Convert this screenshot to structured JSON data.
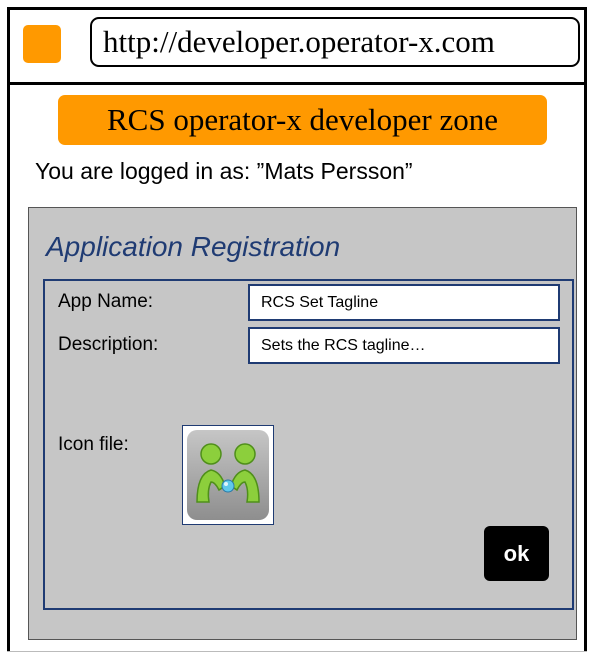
{
  "browser": {
    "url": "http://developer.operator-x.com",
    "button_icon": "square-icon",
    "accent_color": "#ff9900"
  },
  "site": {
    "banner_title": "RCS operator-x developer zone",
    "login_status": "You are logged in as: ”Mats Persson”"
  },
  "registration": {
    "title": "Application Registration",
    "title_color": "#1f3b73",
    "app_name_label": "App Name:",
    "app_name_value": "RCS Set Tagline",
    "description_label": "Description:",
    "description_value": "Sets the RCS tagline…",
    "icon_label": "Icon file:",
    "icon_image": "two-people-chat-icon",
    "ok_label": "ok"
  }
}
